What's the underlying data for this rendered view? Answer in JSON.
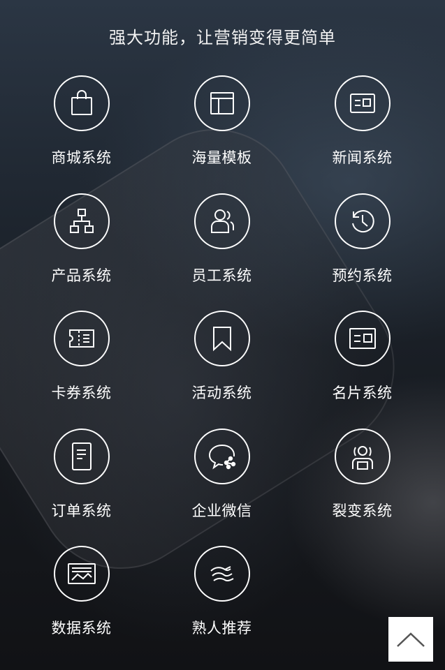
{
  "header": {
    "title": "强大功能，让营销变得更简单"
  },
  "features": [
    {
      "label": "商城系统",
      "icon": "shopping-bag-icon"
    },
    {
      "label": "海量模板",
      "icon": "template-layout-icon"
    },
    {
      "label": "新闻系统",
      "icon": "news-card-icon"
    },
    {
      "label": "产品系统",
      "icon": "org-chart-icon"
    },
    {
      "label": "员工系统",
      "icon": "staff-users-icon"
    },
    {
      "label": "预约系统",
      "icon": "clock-history-icon"
    },
    {
      "label": "卡券系统",
      "icon": "coupon-ticket-icon"
    },
    {
      "label": "活动系统",
      "icon": "bookmark-icon"
    },
    {
      "label": "名片系统",
      "icon": "business-card-icon"
    },
    {
      "label": "订单系统",
      "icon": "order-document-icon"
    },
    {
      "label": "企业微信",
      "icon": "chat-share-icon"
    },
    {
      "label": "裂变系统",
      "icon": "fission-user-icon"
    },
    {
      "label": "数据系统",
      "icon": "data-chart-icon"
    },
    {
      "label": "熟人推荐",
      "icon": "handshake-icon"
    }
  ],
  "colors": {
    "icon_stroke": "#ffffff",
    "back_to_top_bg": "#ffffff",
    "back_to_top_arrow": "#555555"
  },
  "back_to_top": {
    "icon": "chevron-up-icon"
  }
}
